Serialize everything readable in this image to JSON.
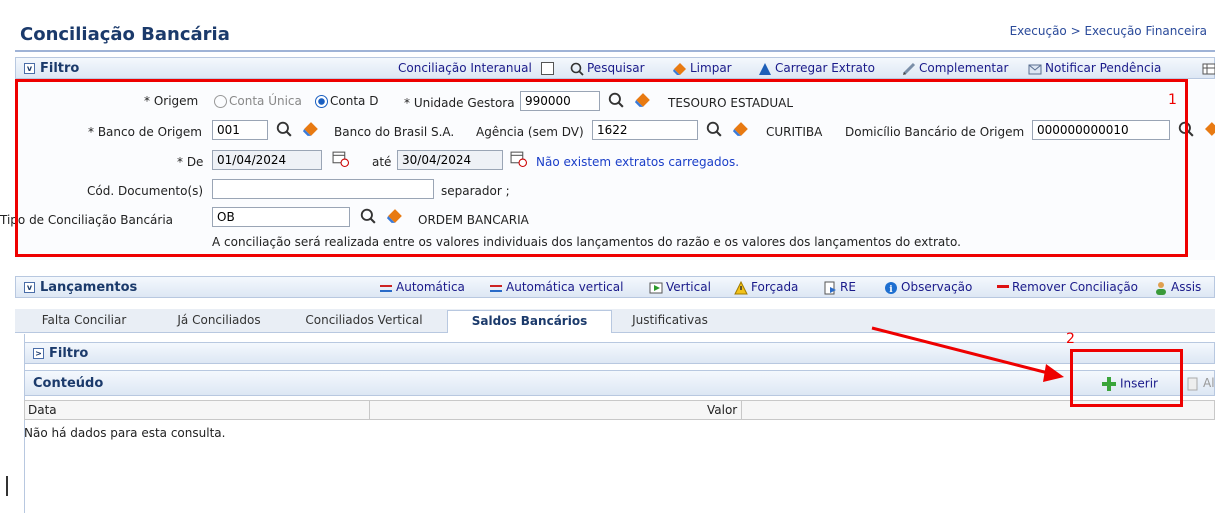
{
  "header": {
    "title": "Conciliação Bancária",
    "breadcrumb": "Execução > Execução Financeira"
  },
  "filter_bar": {
    "label": "Filtro",
    "toolbar": [
      {
        "label": "Conciliação Interanual"
      },
      {
        "label": "Pesquisar"
      },
      {
        "label": "Limpar"
      },
      {
        "label": "Carregar Extrato"
      },
      {
        "label": "Complementar"
      },
      {
        "label": "Notificar Pendência"
      }
    ]
  },
  "annotation": {
    "one": "1",
    "two": "2"
  },
  "form": {
    "origem": {
      "label": "* Origem",
      "option1": "Conta Única",
      "option2": "Conta D"
    },
    "unidade_gestora": {
      "label": "* Unidade Gestora",
      "value": "990000",
      "desc": "TESOURO ESTADUAL"
    },
    "banco": {
      "label": "* Banco de Origem",
      "value": "001",
      "desc": "Banco do Brasil S.A."
    },
    "agencia": {
      "label": "Agência (sem DV)",
      "value": "1622",
      "desc": "CURITIBA"
    },
    "domicilio": {
      "label": "Domicílio Bancário de Origem",
      "value": "000000000010"
    },
    "de": {
      "label": "* De",
      "value": "01/04/2024"
    },
    "ate": {
      "label": "até",
      "value": "30/04/2024"
    },
    "extrato_msg": "Não existem extratos carregados.",
    "cod_doc": {
      "label": "Cód. Documento(s)",
      "value": "",
      "separador": "separador ;"
    },
    "tipo": {
      "label": "Tipo de Conciliação Bancária",
      "value": "OB",
      "desc": "ORDEM BANCARIA"
    },
    "info": "A conciliação será realizada entre os valores individuais dos lançamentos do razão e os valores dos lançamentos do extrato."
  },
  "lancamentos_bar": {
    "label": "Lançamentos",
    "toolbar": [
      {
        "label": "Automática"
      },
      {
        "label": "Automática vertical"
      },
      {
        "label": "Vertical"
      },
      {
        "label": "Forçada"
      },
      {
        "label": "RE"
      },
      {
        "label": "Observação"
      },
      {
        "label": "Remover Conciliação"
      },
      {
        "label": "Assis"
      }
    ]
  },
  "tabs": [
    {
      "label": "Falta Conciliar"
    },
    {
      "label": "Já Conciliados"
    },
    {
      "label": "Conciliados Vertical"
    },
    {
      "label": "Saldos Bancários"
    },
    {
      "label": "Justificativas"
    }
  ],
  "sub_filter": {
    "label": "Filtro"
  },
  "conteudo": {
    "label": "Conteúdo",
    "insert": "Inserir",
    "alt": "Al"
  },
  "table": {
    "columns": [
      "Data",
      "Valor"
    ],
    "empty": "Não há dados para esta consulta."
  }
}
